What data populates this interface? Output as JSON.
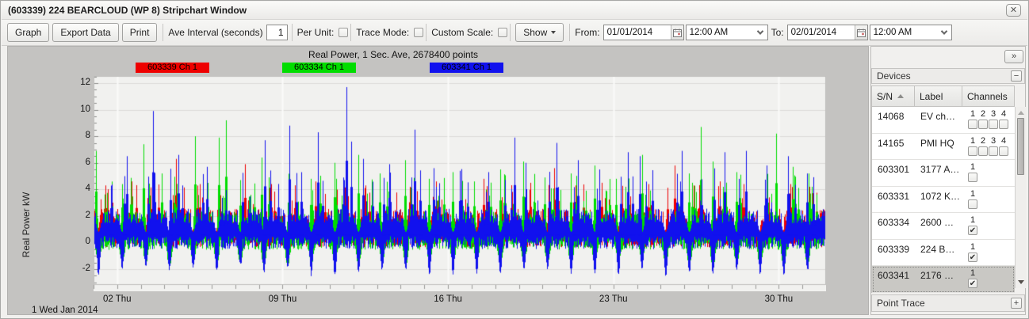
{
  "window": {
    "title": "(603339) 224 BEARCLOUD (WP 8) Stripchart Window",
    "close_glyph": "✕"
  },
  "toolbar": {
    "graph_label": "Graph",
    "export_label": "Export Data",
    "print_label": "Print",
    "ave_interval_label": "Ave Interval (seconds)",
    "ave_interval_value": "1",
    "per_unit_label": "Per Unit:",
    "per_unit_checked": false,
    "trace_mode_label": "Trace Mode:",
    "trace_mode_checked": false,
    "custom_scale_label": "Custom Scale:",
    "custom_scale_checked": false,
    "show_label": "Show",
    "from_label": "From:",
    "from_date": "01/01/2014",
    "from_time": "12:00 AM",
    "to_label": "To:",
    "to_date": "02/01/2014",
    "to_time": "12:00 AM"
  },
  "chart_data": {
    "type": "line",
    "title": "Real Power, 1 Sec. Ave, 2678400 points",
    "ylabel": "Real Power kW",
    "x_start_label": "1 Wed Jan 2014",
    "x_tick_labels": [
      "02 Thu",
      "09 Thu",
      "16 Thu",
      "23 Thu",
      "30 Thu"
    ],
    "x_tick_days": [
      2,
      9,
      16,
      23,
      30
    ],
    "x_range_days": [
      1,
      32
    ],
    "y_ticks": [
      -2,
      0,
      2,
      4,
      6,
      8,
      10,
      12
    ],
    "ylim": [
      -3.25,
      12.55
    ],
    "grid": true,
    "plot_bg": "#f1f1ef",
    "grid_color": "#dcdbd9",
    "week_gridline_color": "#fbfbfa",
    "series": [
      {
        "name": "603339 Ch 1",
        "color": "#ee0000",
        "band": [
          -0.35,
          2.55
        ],
        "daily_dip": -0.7,
        "dip_window": [
          0.1,
          0.22
        ],
        "minor_spikes_per_day": 3,
        "minor_spike_range": [
          2.8,
          4.4
        ],
        "spikes": [
          [
            1.5,
            4.3
          ],
          [
            2.6,
            4.6
          ],
          [
            4.5,
            6.3
          ],
          [
            5.5,
            4.4
          ],
          [
            7.4,
            5.9
          ],
          [
            8.5,
            4.4
          ],
          [
            10.4,
            4.6
          ],
          [
            12.5,
            4.3
          ],
          [
            13.5,
            4.5
          ],
          [
            14.4,
            4.2
          ],
          [
            15.5,
            4.6
          ],
          [
            16.5,
            4.3
          ],
          [
            17.5,
            4.8
          ],
          [
            18.4,
            4.4
          ],
          [
            19.5,
            4.5
          ],
          [
            20.5,
            5.6
          ],
          [
            21.4,
            4.3
          ],
          [
            22.5,
            4.5
          ],
          [
            23.5,
            4.2
          ],
          [
            24.5,
            4.4
          ],
          [
            25.6,
            5.8
          ],
          [
            26.4,
            4.3
          ],
          [
            27.5,
            4.6
          ],
          [
            28.5,
            4.4
          ],
          [
            29.5,
            4.7
          ],
          [
            30.5,
            4.4
          ],
          [
            31.3,
            4.2
          ]
        ]
      },
      {
        "name": "603334 Ch 1",
        "color": "#00dd00",
        "band": [
          -0.55,
          2.35
        ],
        "daily_dip": -1.7,
        "dip_window": [
          0.05,
          0.35
        ],
        "minor_spikes_per_day": 3,
        "minor_spike_range": [
          2.8,
          5.2
        ],
        "spikes": [
          [
            1.1,
            6.9
          ],
          [
            2.2,
            4.4
          ],
          [
            3.1,
            7.4
          ],
          [
            3.9,
            5.2
          ],
          [
            5.3,
            8.0
          ],
          [
            6.6,
            9.2
          ],
          [
            6.3,
            7.9
          ],
          [
            7.2,
            4.7
          ],
          [
            8.1,
            6.4
          ],
          [
            9.3,
            5.4
          ],
          [
            10.2,
            4.8
          ],
          [
            11.2,
            6.0
          ],
          [
            12.2,
            6.6
          ],
          [
            13.1,
            5.2
          ],
          [
            14.2,
            6.2
          ],
          [
            15.2,
            4.8
          ],
          [
            16.2,
            5.3
          ],
          [
            17.1,
            4.6
          ],
          [
            18.2,
            5.5
          ],
          [
            19.2,
            6.1
          ],
          [
            20.1,
            4.9
          ],
          [
            21.2,
            5.2
          ],
          [
            22.2,
            5.8
          ],
          [
            23.1,
            4.8
          ],
          [
            24.2,
            6.6
          ],
          [
            26.7,
            8.7
          ],
          [
            26.2,
            5.2
          ],
          [
            27.2,
            6.1
          ],
          [
            28.2,
            5.3
          ],
          [
            29.9,
            8.2
          ],
          [
            30.6,
            5.7
          ],
          [
            31.4,
            4.2
          ]
        ]
      },
      {
        "name": "603341 Ch 1",
        "color": "#1111ee",
        "band": [
          -0.5,
          2.55
        ],
        "daily_dip": -2.4,
        "dip_window": [
          0.1,
          0.3
        ],
        "minor_spikes_per_day": 2,
        "minor_spike_range": [
          3.0,
          5.6
        ],
        "spikes": [
          [
            2.4,
            6.5
          ],
          [
            3.5,
            9.9
          ],
          [
            4.6,
            6.6
          ],
          [
            5.8,
            5.7
          ],
          [
            7.3,
            4.8
          ],
          [
            8.25,
            7.7
          ],
          [
            9.3,
            8.8
          ],
          [
            10.5,
            8.3
          ],
          [
            11.7,
            11.7
          ],
          [
            11.9,
            7.6
          ],
          [
            12.4,
            6.3
          ],
          [
            13.5,
            5.9
          ],
          [
            14.6,
            8.5
          ],
          [
            15.4,
            5.6
          ],
          [
            16.5,
            5.4
          ],
          [
            18.8,
            7.9
          ],
          [
            19.3,
            6.0
          ],
          [
            20.6,
            7.5
          ],
          [
            21.5,
            6.2
          ],
          [
            22.4,
            5.5
          ],
          [
            23.6,
            6.8
          ],
          [
            24.1,
            6.5
          ],
          [
            25.9,
            6.9
          ],
          [
            27.7,
            6.8
          ],
          [
            28.6,
            6.9
          ],
          [
            29.5,
            5.8
          ],
          [
            30.4,
            6.5
          ],
          [
            31.2,
            5.2
          ]
        ]
      }
    ]
  },
  "panel": {
    "collapse_glyph": "»",
    "devices_title": "Devices",
    "devices_collapse_glyph": "−",
    "point_trace_title": "Point Trace",
    "point_trace_expand_glyph": "+",
    "check_glyph": "✔",
    "table": {
      "columns": [
        "S/N",
        "Label",
        "Channels"
      ],
      "sorted_column": "S/N",
      "rows": [
        {
          "sn": "14068",
          "label": "EV ch…",
          "channels": [
            "1",
            "2",
            "3",
            "4"
          ],
          "checked": [
            false,
            false,
            false,
            false
          ],
          "selected": false
        },
        {
          "sn": "14165",
          "label": "PMI HQ",
          "channels": [
            "1",
            "2",
            "3",
            "4"
          ],
          "checked": [
            false,
            false,
            false,
            false
          ],
          "selected": false
        },
        {
          "sn": "603301",
          "label": "3177 A…",
          "channels": [
            "1"
          ],
          "checked": [
            false
          ],
          "selected": false
        },
        {
          "sn": "603331",
          "label": "1072 K…",
          "channels": [
            "1"
          ],
          "checked": [
            false
          ],
          "selected": false
        },
        {
          "sn": "603334",
          "label": "2600 …",
          "channels": [
            "1"
          ],
          "checked": [
            true
          ],
          "selected": false
        },
        {
          "sn": "603339",
          "label": "224 B…",
          "channels": [
            "1"
          ],
          "checked": [
            true
          ],
          "selected": false
        },
        {
          "sn": "603341",
          "label": "2176 …",
          "channels": [
            "1"
          ],
          "checked": [
            true
          ],
          "selected": true
        }
      ]
    }
  }
}
